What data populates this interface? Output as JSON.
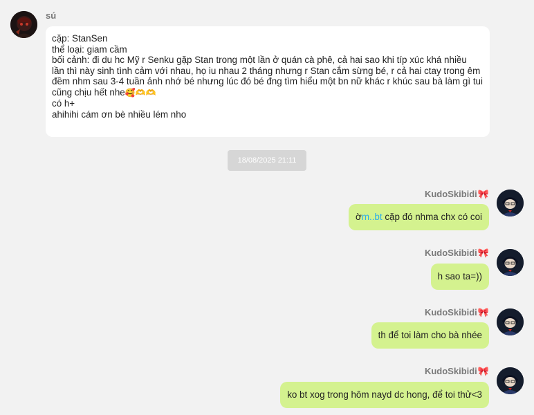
{
  "incoming": {
    "sender": "sú",
    "lines": [
      "cặp: StanSen",
      "thể loại: giam cầm",
      "bối cảnh: đi du hc Mỹ r Senku gặp Stan trong một lần ở quán cà phê, cả hai sao khi típ xúc khá nhiều",
      "lần thì này sinh tình cảm với nhau, họ iu nhau 2 tháng nhưng r Stan cắm sừng bé, r cả hai ctay trong êm",
      "đềm nhm sau 3-4 tuần ảnh nhớ bé nhưng lúc đó bé đng tìm hiểu một bn nữ khác r khúc sau bà làm gì tui",
      "cũng chịu hết nhe",
      "có h+",
      "ahihihi cám ơn bè nhiều lém nho"
    ],
    "line6_emojis": "🥰🫶🫶"
  },
  "timestamp": "18/08/2025 21:11",
  "outgoing": [
    {
      "sender": "KudoSkibidi",
      "bow": "🎀",
      "text_prefix": "ờ",
      "text_link": "m..bt",
      "text_suffix": " cặp đó nhma chx có coi"
    },
    {
      "sender": "KudoSkibidi",
      "bow": "🎀",
      "text": "h sao ta=))"
    },
    {
      "sender": "KudoSkibidi",
      "bow": "🎀",
      "text": "th để toi làm cho bà nhée"
    },
    {
      "sender": "KudoSkibidi",
      "bow": "🎀",
      "text": "ko bt xog trong hôm nayd dc hong, để toi thử<3"
    }
  ],
  "colors": {
    "background": "#f2f2f2",
    "incoming_bubble": "#ffffff",
    "outgoing_bubble": "#d4f28f",
    "link": "#2eaee8",
    "timestamp_bg": "#d6d6d6"
  }
}
